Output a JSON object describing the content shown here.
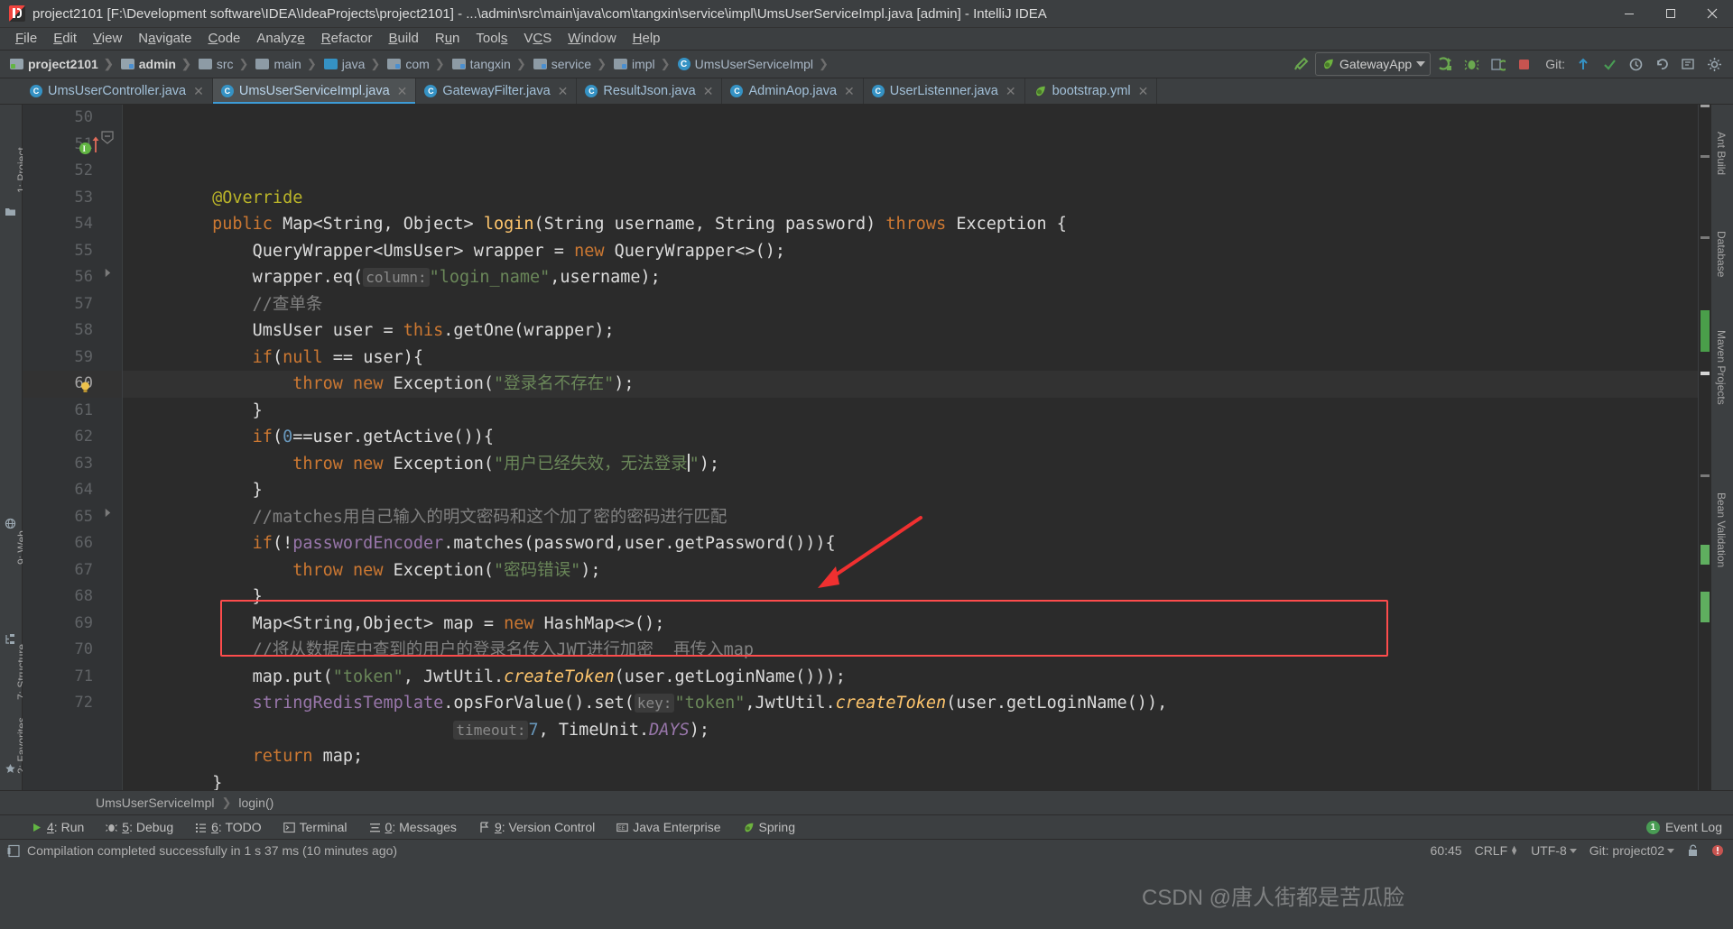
{
  "window": {
    "title": "project2101 [F:\\Development software\\IDEA\\IdeaProjects\\project2101] - ...\\admin\\src\\main\\java\\com\\tangxin\\service\\impl\\UmsUserServiceImpl.java [admin] - IntelliJ IDEA",
    "app_icon": "intellij-idea-icon",
    "minimize": "—",
    "maximize": "❐",
    "close": "✕"
  },
  "menu": {
    "items": [
      "File",
      "Edit",
      "View",
      "Navigate",
      "Code",
      "Analyze",
      "Refactor",
      "Build",
      "Run",
      "Tools",
      "VCS",
      "Window",
      "Help"
    ]
  },
  "navbar": {
    "crumbs": [
      {
        "label": "project2101",
        "icon": "project-folder-icon",
        "bold": true
      },
      {
        "label": "admin",
        "icon": "module-folder-icon",
        "bold": true
      },
      {
        "label": "src",
        "icon": "folder-icon",
        "bold": false
      },
      {
        "label": "main",
        "icon": "folder-icon",
        "bold": false
      },
      {
        "label": "java",
        "icon": "source-folder-icon",
        "bold": false
      },
      {
        "label": "com",
        "icon": "package-folder-icon",
        "bold": false
      },
      {
        "label": "tangxin",
        "icon": "package-folder-icon",
        "bold": false
      },
      {
        "label": "service",
        "icon": "package-folder-icon",
        "bold": false
      },
      {
        "label": "impl",
        "icon": "package-folder-icon",
        "bold": false
      },
      {
        "label": "UmsUserServiceImpl",
        "icon": "java-class-icon",
        "bold": false
      }
    ],
    "run_config": {
      "label": "GatewayApp",
      "icon": "spring-boot-leaf-icon"
    },
    "git_label": "Git:",
    "buttons": [
      "build-hammer-icon",
      "run-icon",
      "debug-icon",
      "coverage-icon",
      "stop-icon",
      "update-project-icon",
      "commit-icon",
      "history-icon",
      "undo-icon",
      "search-everywhere-icon",
      "settings-icon"
    ]
  },
  "tabs": [
    {
      "label": "UmsUserController.java",
      "icon": "java-class-icon",
      "active": false
    },
    {
      "label": "UmsUserServiceImpl.java",
      "icon": "java-class-icon",
      "active": true
    },
    {
      "label": "GatewayFilter.java",
      "icon": "java-class-icon",
      "active": false
    },
    {
      "label": "ResultJson.java",
      "icon": "java-class-icon",
      "active": false
    },
    {
      "label": "AdminAop.java",
      "icon": "java-class-icon",
      "active": false
    },
    {
      "label": "UserListenner.java",
      "icon": "java-class-icon",
      "active": false
    },
    {
      "label": "bootstrap.yml",
      "icon": "spring-yaml-icon",
      "active": false
    }
  ],
  "left_toolbars": [
    {
      "label": "1: Project",
      "name": "tool-project"
    },
    {
      "label": "9: Web",
      "name": "tool-web"
    },
    {
      "label": "7: Structure",
      "name": "tool-structure"
    },
    {
      "label": "2: Favorites",
      "name": "tool-favorites"
    }
  ],
  "right_toolbars": [
    {
      "label": "Ant Build",
      "name": "tool-ant-build"
    },
    {
      "label": "Database",
      "name": "tool-database"
    },
    {
      "label": "Maven Projects",
      "name": "tool-maven"
    },
    {
      "label": "Bean Validation",
      "name": "tool-bean-validation"
    }
  ],
  "editor": {
    "first_line": 50,
    "cursor_position": "60:45",
    "lines": [
      {
        "n": 50,
        "indent": 2,
        "tokens": [
          {
            "t": "@Override",
            "c": "anno"
          }
        ]
      },
      {
        "n": 51,
        "indent": 2,
        "gutter_icons": [
          "implementing-method-icon",
          "override-arrow-icon"
        ],
        "fold": "collapse-icon",
        "tokens": [
          {
            "t": "public ",
            "c": "kw"
          },
          {
            "t": "Map<String, Object> ",
            "c": "white"
          },
          {
            "t": "login",
            "c": "fn"
          },
          {
            "t": "(String username, String password) ",
            "c": "white"
          },
          {
            "t": "throws ",
            "c": "kw"
          },
          {
            "t": "Exception {",
            "c": "white"
          }
        ]
      },
      {
        "n": 52,
        "indent": 3,
        "tokens": [
          {
            "t": "QueryWrapper<UmsUser> wrapper = ",
            "c": "white"
          },
          {
            "t": "new ",
            "c": "kw"
          },
          {
            "t": "QueryWrapper<>();",
            "c": "white"
          }
        ]
      },
      {
        "n": 53,
        "indent": 3,
        "tokens": [
          {
            "t": "wrapper.eq(",
            "c": "white"
          },
          {
            "t": "column:",
            "c": "hint"
          },
          {
            "t": "\"login_name\"",
            "c": "str"
          },
          {
            "t": ",username);",
            "c": "white"
          }
        ]
      },
      {
        "n": 54,
        "indent": 3,
        "tokens": [
          {
            "t": "//查单条",
            "c": "cmt"
          }
        ]
      },
      {
        "n": 55,
        "indent": 3,
        "tokens": [
          {
            "t": "UmsUser user = ",
            "c": "white"
          },
          {
            "t": "this",
            "c": "kw"
          },
          {
            "t": ".getOne(wrapper);",
            "c": "white"
          }
        ]
      },
      {
        "n": 56,
        "indent": 3,
        "fold": "expand-icon",
        "tokens": [
          {
            "t": "if",
            "c": "kw"
          },
          {
            "t": "(",
            "c": "white"
          },
          {
            "t": "null",
            "c": "kw"
          },
          {
            "t": " == user){",
            "c": "white"
          }
        ]
      },
      {
        "n": 57,
        "indent": 4,
        "tokens": [
          {
            "t": "throw new ",
            "c": "kw"
          },
          {
            "t": "Exception(",
            "c": "white"
          },
          {
            "t": "\"登录名不存在\"",
            "c": "str"
          },
          {
            "t": ");",
            "c": "white"
          }
        ]
      },
      {
        "n": 58,
        "indent": 3,
        "tokens": [
          {
            "t": "}",
            "c": "white"
          }
        ]
      },
      {
        "n": 59,
        "indent": 3,
        "tokens": [
          {
            "t": "if",
            "c": "kw"
          },
          {
            "t": "(",
            "c": "white"
          },
          {
            "t": "0",
            "c": "num"
          },
          {
            "t": "==user.getActive()){",
            "c": "white"
          }
        ]
      },
      {
        "n": 60,
        "indent": 4,
        "current": true,
        "gutter_icons": [
          "intention-bulb-icon"
        ],
        "tokens": [
          {
            "t": "throw new ",
            "c": "kw"
          },
          {
            "t": "Exception(",
            "c": "white"
          },
          {
            "t": "\"用户已经失效，无法登录",
            "c": "str"
          },
          {
            "t": "|CARET|",
            "c": "caret"
          },
          {
            "t": "\"",
            "c": "str"
          },
          {
            "t": ");",
            "c": "white"
          }
        ]
      },
      {
        "n": 61,
        "indent": 3,
        "tokens": [
          {
            "t": "}",
            "c": "white"
          }
        ]
      },
      {
        "n": 62,
        "indent": 3,
        "tokens": [
          {
            "t": "//matches用自己输入的明文密码和这个加了密的密码进行匹配",
            "c": "cmt"
          }
        ]
      },
      {
        "n": 63,
        "indent": 3,
        "tokens": [
          {
            "t": "if",
            "c": "kw"
          },
          {
            "t": "(!",
            "c": "white"
          },
          {
            "t": "passwordEncoder",
            "c": "fld"
          },
          {
            "t": ".matches(password,user.getPassword())){",
            "c": "white"
          }
        ]
      },
      {
        "n": 64,
        "indent": 4,
        "tokens": [
          {
            "t": "throw new ",
            "c": "kw"
          },
          {
            "t": "Exception(",
            "c": "white"
          },
          {
            "t": "\"密码错误\"",
            "c": "str"
          },
          {
            "t": ");",
            "c": "white"
          }
        ]
      },
      {
        "n": 65,
        "indent": 3,
        "fold": "expand-icon",
        "tokens": [
          {
            "t": "}",
            "c": "white"
          }
        ]
      },
      {
        "n": 66,
        "indent": 3,
        "tokens": [
          {
            "t": "Map<String,Object> map = ",
            "c": "white"
          },
          {
            "t": "new ",
            "c": "kw"
          },
          {
            "t": "HashMap<>();",
            "c": "white"
          }
        ]
      },
      {
        "n": 67,
        "indent": 3,
        "tokens": [
          {
            "t": "//将从数据库中查到的用户的登录名传入JWT进行加密  再传入map",
            "c": "cmt"
          }
        ]
      },
      {
        "n": 68,
        "indent": 3,
        "tokens": [
          {
            "t": "map.put(",
            "c": "white"
          },
          {
            "t": "\"token\"",
            "c": "str"
          },
          {
            "t": ", JwtUtil.",
            "c": "white"
          },
          {
            "t": "createToken",
            "c": "fni"
          },
          {
            "t": "(user.getLoginName()));",
            "c": "white"
          }
        ]
      },
      {
        "n": 69,
        "indent": 3,
        "highlight": true,
        "tokens": [
          {
            "t": "stringRedisTemplate",
            "c": "fld"
          },
          {
            "t": ".opsForValue().set(",
            "c": "white"
          },
          {
            "t": "key:",
            "c": "hint"
          },
          {
            "t": "\"token\"",
            "c": "str"
          },
          {
            "t": ",JwtUtil.",
            "c": "white"
          },
          {
            "t": "createToken",
            "c": "fni"
          },
          {
            "t": "(user.getLoginName()),",
            "c": "white"
          }
        ]
      },
      {
        "n": 70,
        "indent": 8,
        "highlight": true,
        "tokens": [
          {
            "t": "timeout:",
            "c": "hint"
          },
          {
            "t": "7",
            "c": "num"
          },
          {
            "t": ", TimeUnit.",
            "c": "white"
          },
          {
            "t": "DAYS",
            "c": "fldi"
          },
          {
            "t": ");",
            "c": "white"
          }
        ]
      },
      {
        "n": 71,
        "indent": 3,
        "tokens": [
          {
            "t": "return ",
            "c": "kw"
          },
          {
            "t": "map;",
            "c": "white"
          }
        ]
      },
      {
        "n": 72,
        "indent": 2,
        "tokens": [
          {
            "t": "}",
            "c": "white"
          }
        ]
      }
    ],
    "annotation": {
      "shape": "red-arrow",
      "target_line": 68
    }
  },
  "structure_bar": {
    "class": "UmsUserServiceImpl",
    "member": "login()"
  },
  "tool_window_bar": {
    "items": [
      {
        "num": "4",
        "label": "Run",
        "icon": "run-icon"
      },
      {
        "num": "5",
        "label": "Debug",
        "icon": "debug-bug-icon"
      },
      {
        "num": "6",
        "label": "TODO",
        "icon": "todo-list-icon"
      },
      {
        "num": "",
        "label": "Terminal",
        "icon": "terminal-icon"
      },
      {
        "num": "0",
        "label": "Messages",
        "icon": "messages-icon"
      },
      {
        "num": "9",
        "label": "Version Control",
        "icon": "version-control-icon"
      },
      {
        "num": "",
        "label": "Java Enterprise",
        "icon": "java-enterprise-icon"
      },
      {
        "num": "",
        "label": "Spring",
        "icon": "spring-leaf-icon"
      }
    ],
    "event_log": {
      "label": "Event Log",
      "count": "1"
    }
  },
  "status_bar": {
    "message": "Compilation completed successfully in 1 s 37 ms (10 minutes ago)",
    "message_icon": "compile-icon",
    "caret": "60:45",
    "line_separator": "CRLF",
    "encoding": "UTF-8",
    "git_branch": "Git: project02",
    "lock_icon": "unlocked-icon",
    "inspections_icon": "inspections-icon"
  },
  "watermark": "CSDN @唐人街都是苦瓜脸",
  "colors": {
    "bg": "#2b2b2b",
    "chrome": "#3c3f41",
    "gutter": "#313335",
    "accent": "#3592c4",
    "highlight_box": "#fd4c4c",
    "string": "#6a8759",
    "keyword": "#cc7832",
    "comment": "#808080",
    "field": "#9876aa",
    "number": "#6897bb",
    "method": "#ffc66d",
    "success": "#499c54"
  }
}
